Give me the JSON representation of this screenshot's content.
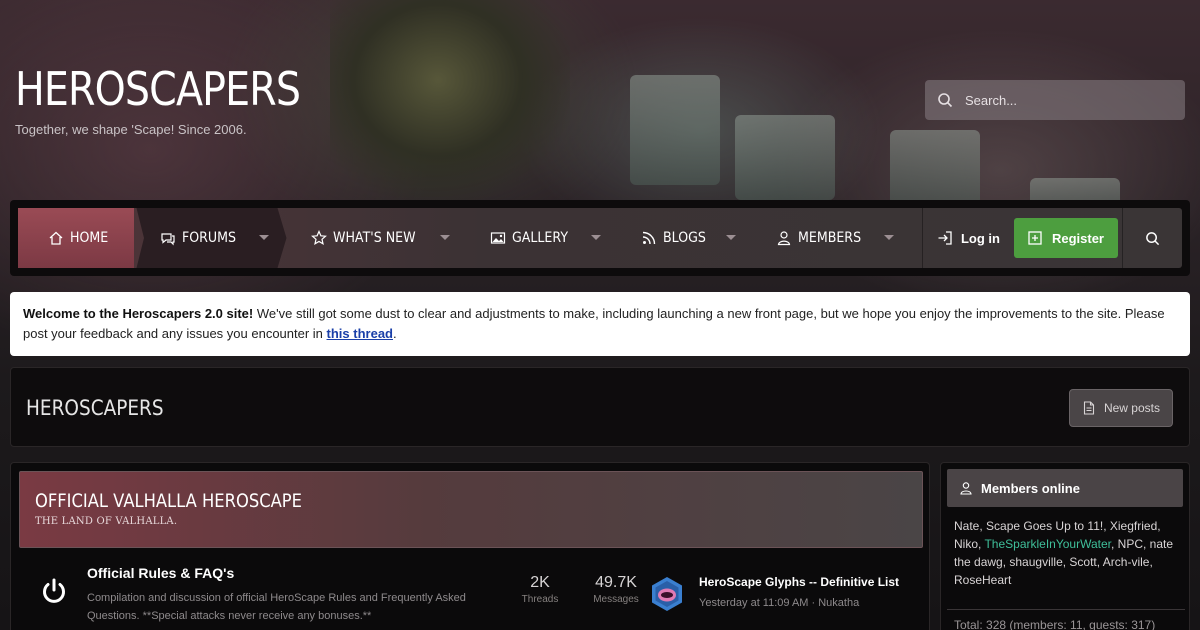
{
  "header": {
    "site_title": "HEROSCAPERS",
    "tagline": "Together, we shape 'Scape! Since 2006.",
    "search_placeholder": "Search..."
  },
  "nav": {
    "items": [
      {
        "label": "HOME",
        "icon": "home-icon"
      },
      {
        "label": "FORUMS",
        "icon": "comments-icon"
      },
      {
        "label": "WHAT'S NEW",
        "icon": "star-icon"
      },
      {
        "label": "GALLERY",
        "icon": "image-icon"
      },
      {
        "label": "BLOGS",
        "icon": "rss-icon"
      },
      {
        "label": "MEMBERS",
        "icon": "user-icon"
      }
    ],
    "login_label": "Log in",
    "register_label": "Register"
  },
  "notice": {
    "bold": "Welcome to the Heroscapers 2.0 site!",
    "text": " We've still got some dust to clear and adjustments to make, including launching a new front page, but we hope you enjoy the improvements to the site. Please post your feedback and any issues you encounter in ",
    "link": "this thread",
    "end": "."
  },
  "page": {
    "title": "HEROSCAPERS",
    "new_posts_label": "New posts"
  },
  "category": {
    "title": "OFFICIAL VALHALLA HEROSCAPE",
    "description": "THE LAND OF VALHALLA."
  },
  "forum": {
    "name": "Official Rules & FAQ's",
    "description": "Compilation and discussion of official HeroScape Rules and Frequently Asked Questions. **Special attacks never receive any bonuses.**",
    "threads_value": "2K",
    "threads_label": "Threads",
    "messages_value": "49.7K",
    "messages_label": "Messages",
    "last_post_title": "HeroScape Glyphs -- Definitive List",
    "last_post_meta": "Yesterday at 11:09 AM · Nukatha"
  },
  "sidebar": {
    "title": "Members online",
    "members": [
      "Nate",
      "Scape Goes Up to 11!",
      "Xiegfried",
      "Niko",
      "TheSparkleInYourWater",
      "NPC",
      "nate the dawg",
      "shaugville",
      "Scott",
      "Arch-vile",
      "RoseHeart"
    ],
    "total": "Total: 328 (members: 11, guests: 317)"
  },
  "colors": {
    "register": "#4d9e3f",
    "home_active": "#9a4b55",
    "highlight_member": "#3fbf9a",
    "link": "#1a3fa8"
  }
}
